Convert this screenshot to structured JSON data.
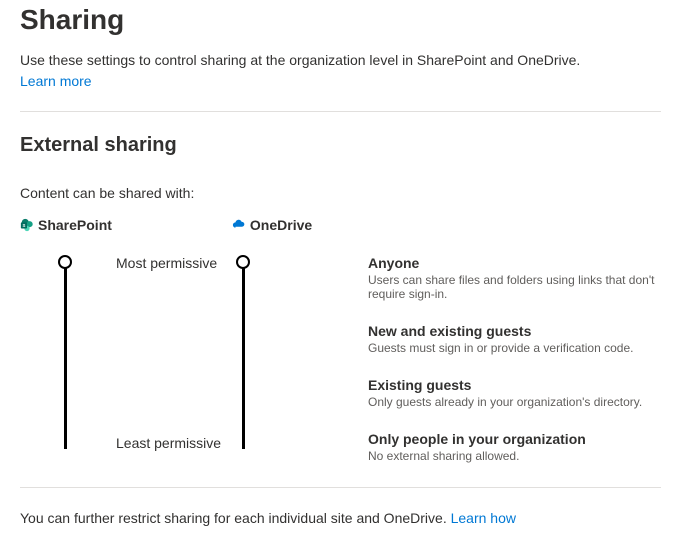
{
  "page": {
    "title": "Sharing",
    "description": "Use these settings to control sharing at the organization level in SharePoint and OneDrive.",
    "learn_more": "Learn more"
  },
  "section": {
    "title": "External sharing",
    "subheading": "Content can be shared with:"
  },
  "products": {
    "sharepoint": "SharePoint",
    "onedrive": "OneDrive"
  },
  "permissions": {
    "most": "Most permissive",
    "least": "Least permissive"
  },
  "options": [
    {
      "title": "Anyone",
      "desc": "Users can share files and folders using links that don't require sign-in."
    },
    {
      "title": "New and existing guests",
      "desc": "Guests must sign in or provide a verification code."
    },
    {
      "title": "Existing guests",
      "desc": "Only guests already in your organization's directory."
    },
    {
      "title": "Only people in your organization",
      "desc": "No external sharing allowed."
    }
  ],
  "footer": {
    "note": "You can further restrict sharing for each individual site and OneDrive. ",
    "link": "Learn how"
  }
}
